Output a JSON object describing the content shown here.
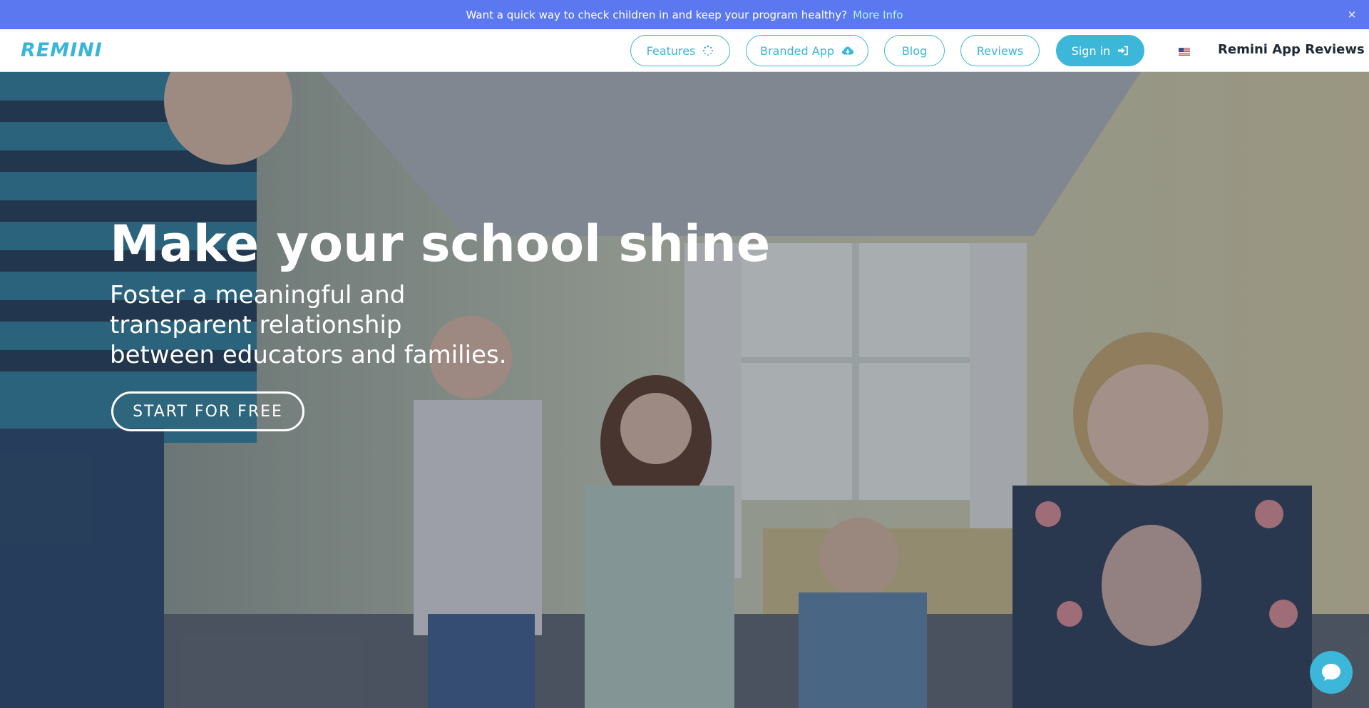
{
  "announcement": {
    "text": "Want a quick way to check children in and keep your program healthy?",
    "more_info": "More Info",
    "close_symbol": "×"
  },
  "brand": {
    "logo_text": "REMINI",
    "accent_color": "#3ab5d8",
    "banner_color": "#5b78f0"
  },
  "nav": {
    "features": "Features",
    "branded_app": "Branded App",
    "blog": "Blog",
    "reviews": "Reviews",
    "sign_in": "Sign in",
    "reviews_link": "Remini App Reviews"
  },
  "hero": {
    "headline": "Make your school shine",
    "subline_1": "Foster a meaningful and",
    "subline_2": "transparent relationship",
    "subline_3": "between educators and families.",
    "cta": "START FOR FREE"
  },
  "icons": {
    "features": "spinner-icon",
    "branded_app": "cloud-download-icon",
    "sign_in": "sign-in-icon",
    "language": "us-flag-icon",
    "chat": "chat-icon"
  }
}
